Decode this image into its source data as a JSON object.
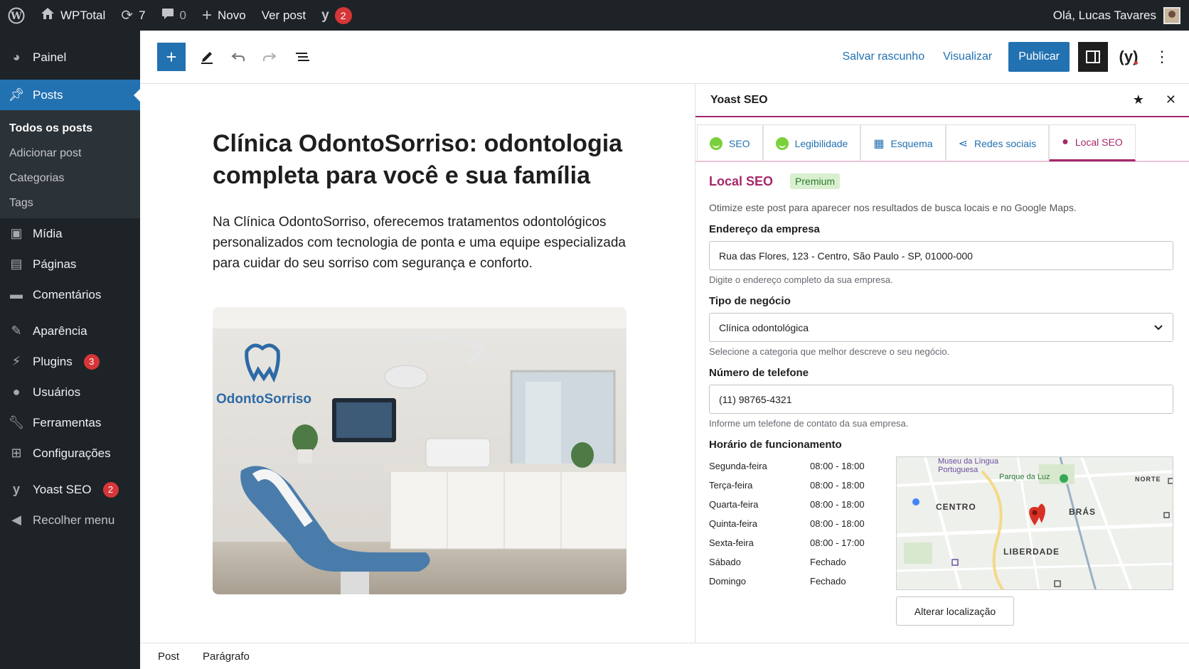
{
  "admin_bar": {
    "site_name": "WPTotal",
    "updates_count": "7",
    "comments_count": "0",
    "new_label": "Novo",
    "view_post_label": "Ver post",
    "yoast_badge": "2",
    "greeting": "Olá, Lucas Tavares"
  },
  "sidebar": {
    "items": {
      "dashboard": "Painel",
      "posts": "Posts",
      "media": "Mídia",
      "pages": "Páginas",
      "comments": "Comentários",
      "appearance": "Aparência",
      "plugins": "Plugins",
      "plugins_badge": "3",
      "users": "Usuários",
      "tools": "Ferramentas",
      "settings": "Configurações",
      "yoast": "Yoast SEO",
      "yoast_badge": "2",
      "collapse": "Recolher menu"
    },
    "submenu": [
      "Todos os posts",
      "Adicionar post",
      "Categorias",
      "Tags"
    ]
  },
  "toolbar": {
    "save_draft": "Salvar rascunho",
    "preview": "Visualizar",
    "publish": "Publicar"
  },
  "post": {
    "title": "Clínica OdontoSorriso: odontologia completa para você e sua família",
    "paragraph": "Na Clínica OdontoSorriso, oferecemos tratamentos odontológicos personalizados com tecnologia de ponta e uma equipe especializada para cuidar do seu sorriso com segurança e conforto.",
    "image_logo_text": "OdontoSorriso"
  },
  "footer": {
    "crumb1": "Post",
    "crumb2": "Parágrafo"
  },
  "yoast": {
    "panel_title": "Yoast SEO",
    "tabs": [
      "SEO",
      "Legibilidade",
      "Esquema",
      "Redes sociais",
      "Local SEO"
    ],
    "local": {
      "title": "Local SEO",
      "badge": "Premium",
      "intro": "Otimize este post para aparecer nos resultados de busca locais e no Google Maps.",
      "address_label": "Endereço da empresa",
      "address_value": "Rua das Flores, 123 - Centro, São Paulo - SP, 01000-000",
      "address_help": "Digite o endereço completo da sua empresa.",
      "business_label": "Tipo de negócio",
      "business_value": "Clínica odontológica",
      "business_help": "Selecione a categoria que melhor descreve o seu negócio.",
      "phone_label": "Número de telefone",
      "phone_value": "(11) 98765-4321",
      "phone_help": "Informe um telefone de contato da sua empresa.",
      "hours_label": "Horário de funcionamento",
      "hours": [
        {
          "day": "Segunda-feira",
          "time": "08:00 - 18:00"
        },
        {
          "day": "Terça-feira",
          "time": "08:00 - 18:00"
        },
        {
          "day": "Quarta-feira",
          "time": "08:00 - 18:00"
        },
        {
          "day": "Quinta-feira",
          "time": "08:00 - 18:00"
        },
        {
          "day": "Sexta-feira",
          "time": "08:00 - 17:00"
        },
        {
          "day": "Sábado",
          "time": "Fechado"
        },
        {
          "day": "Domingo",
          "time": "Fechado"
        }
      ],
      "map_labels": {
        "museum": "Museu da Língua Portuguesa",
        "park": "Parque da Luz",
        "centro": "CENTRO",
        "bras": "BRÁS",
        "liberdade": "LIBERDADE",
        "norte": "NORTE"
      },
      "change_location": "Alterar localização"
    }
  },
  "colors": {
    "admin_dark": "#1d2327",
    "wp_blue": "#2271b1",
    "yoast_purple": "#a4286a",
    "badge_red": "#d63638"
  }
}
